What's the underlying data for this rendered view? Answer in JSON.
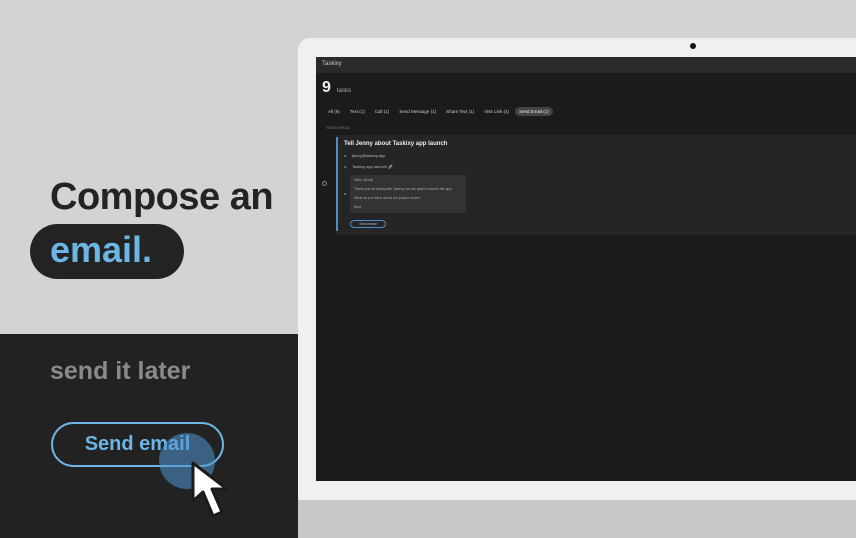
{
  "promo": {
    "headline": "Compose an",
    "highlight": "email.",
    "subline": "send it later",
    "cta_label": "Send email"
  },
  "app": {
    "title": "Taskixy",
    "task_count": "9",
    "task_word": "tasks",
    "tabs": [
      {
        "label": "All (9)"
      },
      {
        "label": "Text (1)"
      },
      {
        "label": "Call (1)"
      },
      {
        "label": "Send Message (1)"
      },
      {
        "label": "Share Text (1)"
      },
      {
        "label": "Visit Link (4)"
      },
      {
        "label": "Send Email (1)"
      }
    ],
    "active_tab": "Send Email (1)",
    "section_label": "SEND EMAIL",
    "task": {
      "title": "Tell Jenny about Taskixy app launch",
      "to": "jenny@taskixy.app",
      "subject": "Taskixy app launch! 🚀",
      "body": [
        "Hello Jenny!",
        "Thank you for being with Taskixy we are glad to launch the app.",
        "What do you think about our project news?",
        "Best"
      ],
      "send_label": "Send email"
    }
  },
  "colors": {
    "accent": "#6bb6e4",
    "dark": "#222222",
    "light": "#d3d3d3"
  }
}
